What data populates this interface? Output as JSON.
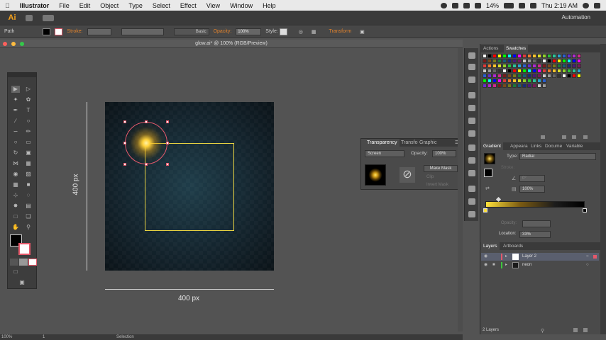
{
  "menubar": {
    "app_name": "Illustrator",
    "items": [
      "File",
      "Edit",
      "Object",
      "Type",
      "Select",
      "Effect",
      "View",
      "Window",
      "Help"
    ],
    "battery": "14%",
    "clock": "Thu 2:19 AM"
  },
  "appbar": {
    "logo": "Ai",
    "workspace": "Automation"
  },
  "controlbar": {
    "selection_type": "Path",
    "stroke_label": "Stroke:",
    "brush_label": "Basic",
    "opacity_label": "Opacity:",
    "opacity_value": "100%",
    "style_label": "Style:",
    "transform_label": "Transform"
  },
  "document": {
    "tab_title": "glow.ai* @ 100% (RGB/Preview)"
  },
  "artboard": {
    "width_label": "400 px",
    "height_label": "400 px"
  },
  "transparency_panel": {
    "tabs": [
      "Transparency",
      "Transfo",
      "Graphic"
    ],
    "blend_mode": "Screen",
    "opacity_label": "Opacity:",
    "opacity_value": "100%",
    "make_mask": "Make Mask",
    "clip": "Clip",
    "invert_mask": "Invert Mask"
  },
  "swatches_panel": {
    "tabs": [
      "Actions",
      "Swatches"
    ]
  },
  "gradient_panel": {
    "tabs": [
      "Gradient",
      "Appeara",
      "Links",
      "Docume",
      "Variable"
    ],
    "type_label": "Type:",
    "type_value": "Radial",
    "stroke_label": "Stroke:",
    "angle_value": "0°",
    "aspect_value": "100%",
    "opacity_label": "Opacity:",
    "location_label": "Location:",
    "location_value": "33%"
  },
  "layers_panel": {
    "tabs": [
      "Layers",
      "Artboards"
    ],
    "layers": [
      {
        "name": "Layer 2",
        "color": "#e5586a"
      },
      {
        "name": "neon",
        "color": "#3cc83c"
      }
    ],
    "count_label": "2 Layers"
  },
  "statusbar": {
    "zoom": "100%",
    "page": "1",
    "tool": "Selection"
  },
  "colors": {
    "accent_orange": "#f7a21b",
    "selection_red": "#e5586a",
    "neon_yellow": "#e9d341"
  }
}
